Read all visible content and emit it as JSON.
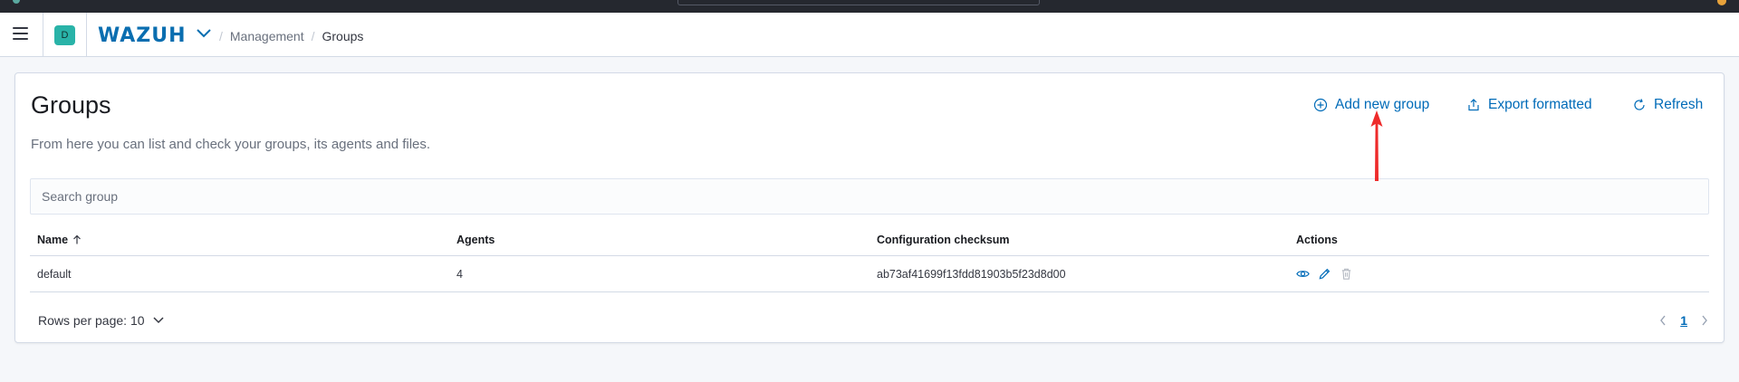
{
  "header": {
    "space_initial": "D",
    "logo": "WAZUH",
    "breadcrumbs": [
      "Management",
      "Groups"
    ]
  },
  "page": {
    "title": "Groups",
    "description": "From here you can list and check your groups, its agents and files."
  },
  "toolbar": {
    "add_label": "Add new group",
    "export_label": "Export formatted",
    "refresh_label": "Refresh"
  },
  "search": {
    "placeholder": "Search group",
    "value": ""
  },
  "table": {
    "columns": [
      "Name",
      "Agents",
      "Configuration checksum",
      "Actions"
    ],
    "sorted_by": "Name",
    "sort_direction": "ascending",
    "rows": [
      {
        "name": "default",
        "agents": "4",
        "checksum": "ab73af41699f13fdd81903b5f23d8d00"
      }
    ]
  },
  "pagination": {
    "rows_per_page_label": "Rows per page: 10",
    "current_page": "1"
  },
  "colors": {
    "accent": "#006bb8",
    "brand": "#0a6eb0",
    "space_badge": "#29b3a8",
    "annotation_arrow": "#ee2b2b",
    "topbar": "#25282f"
  },
  "icons": {
    "menu": "hamburger-icon",
    "add": "plus-circle-icon",
    "export": "export-icon",
    "refresh": "refresh-icon",
    "view": "eye-icon",
    "edit": "pencil-icon",
    "delete": "trash-icon"
  }
}
